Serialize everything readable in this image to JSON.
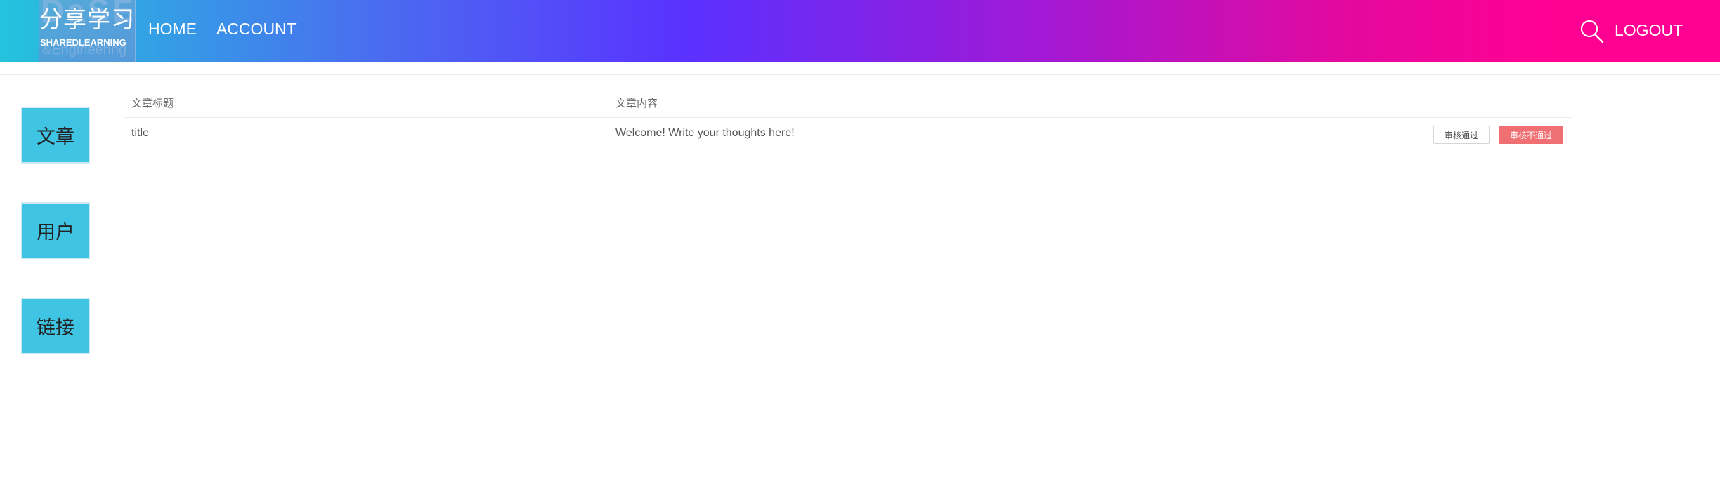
{
  "header": {
    "logo": {
      "title_cn": "分享学习",
      "title_en": "SHAREDLEARNING",
      "watermark_top": "DaSE",
      "watermark_bottom": "&Engineering"
    },
    "nav": {
      "home": "HOME",
      "account": "ACCOUNT",
      "logout": "LOGOUT"
    },
    "search_icon": "search-icon",
    "gradient_colors": [
      "#24c3dd",
      "#5a31ff",
      "#ff0093"
    ]
  },
  "sidebar": {
    "items": [
      {
        "label": "文章"
      },
      {
        "label": "用户"
      },
      {
        "label": "链接"
      }
    ],
    "color": "#40c4e3"
  },
  "table": {
    "columns": [
      "文章标题",
      "文章内容"
    ],
    "rows": [
      {
        "title": "title",
        "content": "Welcome! Write your thoughts here!",
        "approve_label": "审核通过",
        "reject_label": "审核不通过"
      }
    ],
    "reject_color": "#ef6f72"
  }
}
